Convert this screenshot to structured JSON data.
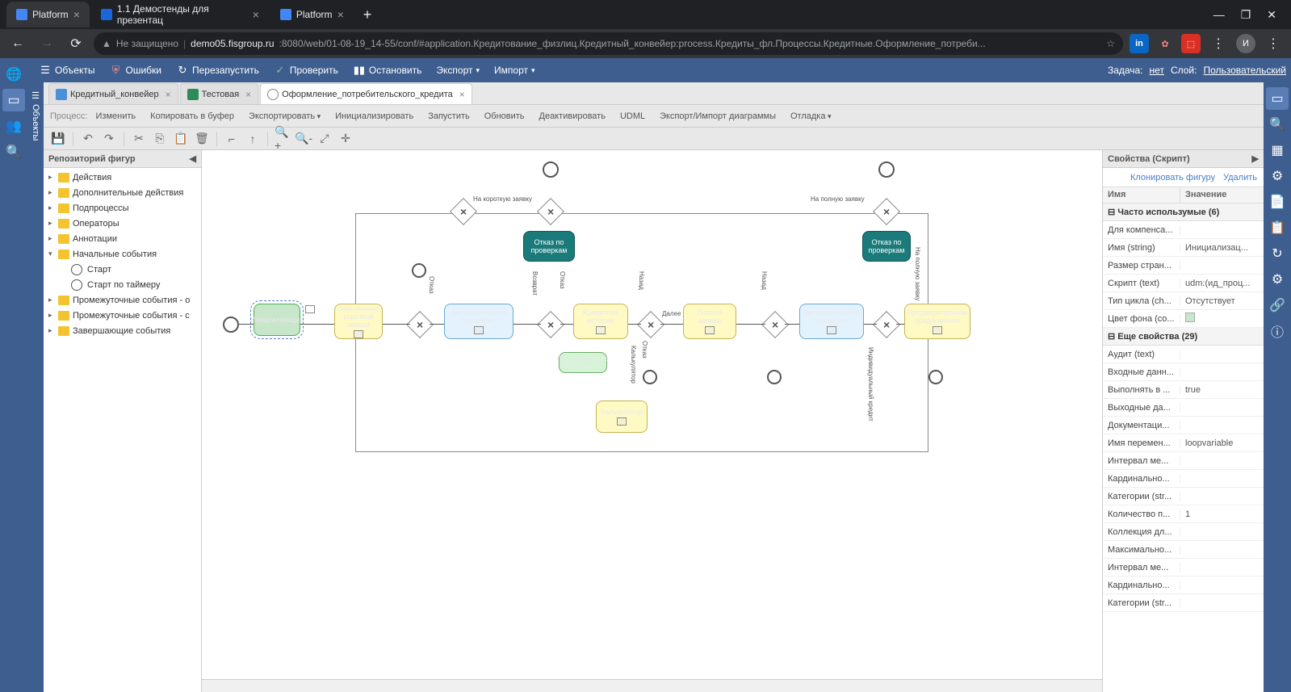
{
  "browser": {
    "tabs": [
      {
        "title": "Platform",
        "favicon": "platform"
      },
      {
        "title": "1.1 Демостенды для презентац",
        "favicon": "confluence"
      },
      {
        "title": "Platform",
        "favicon": "platform"
      }
    ],
    "url_prefix": "Не защищено",
    "url_domain": "demo05.fisgroup.ru",
    "url_path": ":8080/web/01-08-19_14-55/conf/#application.Кредитование_физлиц.Кредитный_конвейер:process.Кредиты_фл.Процессы.Кредитные.Оформление_потреби..."
  },
  "toolbar": {
    "objects": "Объекты",
    "errors": "Ошибки",
    "restart": "Перезапустить",
    "check": "Проверить",
    "stop": "Остановить",
    "export": "Экспорт",
    "import": "Импорт",
    "task_label": "Задача:",
    "task_value": "нет",
    "layer_label": "Слой:",
    "layer_value": "Пользовательский"
  },
  "side_label": "Объекты",
  "editor_tabs": [
    {
      "label": "Кредитный_конвейер",
      "type": "form"
    },
    {
      "label": "Тестовая",
      "type": "table"
    },
    {
      "label": "Оформление_потребительского_кредита",
      "type": "flow"
    }
  ],
  "process_menu": {
    "label": "Процесс:",
    "items": [
      "Изменить",
      "Копировать в буфер",
      "Экспортировать",
      "Инициализировать",
      "Запустить",
      "Обновить",
      "Деактивировать",
      "UDML",
      "Экспорт/Импорт диаграммы",
      "Отладка"
    ]
  },
  "shapes_panel": {
    "title": "Репозиторий фигур",
    "folders": [
      "Действия",
      "Дополнительные действия",
      "Подпроцессы",
      "Операторы",
      "Аннотации",
      "Начальные события"
    ],
    "start_items": [
      "Старт",
      "Старт по таймеру"
    ],
    "more_folders": [
      "Промежуточные события - о",
      "Промежуточные события - с",
      "Завершающие события"
    ]
  },
  "bpmn": {
    "init": "Инициализация",
    "short_app": "Заполнение короткой заявки",
    "auto_checks": "Автоматические проверки",
    "reject_checks": "Отказ по проверкам",
    "credit_history": "Кредитная история",
    "reassign": "Переприсвоение Ид процесса",
    "calculator": "Калькулятор",
    "full_app": "Полная заявка",
    "auto_checks2": "Автоматические проверки",
    "reject_checks2": "Отказ по проверкам",
    "pre_offer": "Предварительное предложение",
    "label_short": "На короткую заявку",
    "label_full": "На полную заявку",
    "label_refuse": "Отказ",
    "label_return": "Возврат",
    "label_back": "Назад",
    "label_next": "Далее",
    "label_calc": "Калькулятор",
    "label_indiv": "Индивидуальный кредит"
  },
  "props": {
    "title": "Свойства (Скрипт)",
    "clone": "Клонировать фигуру",
    "delete": "Удалить",
    "col_name": "Имя",
    "col_value": "Значение",
    "group1": "Часто использумые (6)",
    "rows1": [
      {
        "k": "Для компенса...",
        "v": ""
      },
      {
        "k": "Имя (string)",
        "v": "Инициализац..."
      },
      {
        "k": "Размер стран...",
        "v": ""
      },
      {
        "k": "Скрипт (text)",
        "v": "udm:(ид_проц..."
      },
      {
        "k": "Тип цикла (ch...",
        "v": "Отсутствует"
      },
      {
        "k": "Цвет фона (co...",
        "v": "#swatch"
      }
    ],
    "group2": "Еще свойства (29)",
    "rows2": [
      {
        "k": "Аудит (text)",
        "v": ""
      },
      {
        "k": "Входные данн...",
        "v": ""
      },
      {
        "k": "Выполнять в ...",
        "v": "true"
      },
      {
        "k": "Выходные да...",
        "v": ""
      },
      {
        "k": "Документаци...",
        "v": ""
      },
      {
        "k": "Имя перемен...",
        "v": "loopvariable"
      },
      {
        "k": "Интервал ме...",
        "v": ""
      },
      {
        "k": "Кардинально...",
        "v": ""
      },
      {
        "k": "Категории (str...",
        "v": ""
      },
      {
        "k": "Количество п...",
        "v": "1"
      },
      {
        "k": "Коллекция дл...",
        "v": ""
      },
      {
        "k": "Максимально...",
        "v": ""
      },
      {
        "k": "Интервал ме...",
        "v": ""
      },
      {
        "k": "Кардинально...",
        "v": ""
      },
      {
        "k": "Категории (str...",
        "v": ""
      }
    ]
  }
}
